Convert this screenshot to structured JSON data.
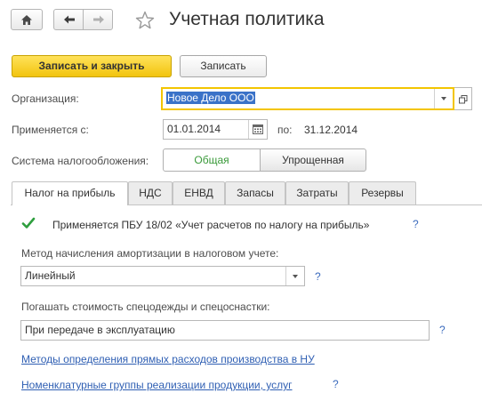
{
  "window": {
    "title": "Учетная политика"
  },
  "toolbar": {
    "save_close_label": "Записать и закрыть",
    "save_label": "Записать"
  },
  "form": {
    "organization_label": "Организация:",
    "organization_value": "Новое Дело ООО",
    "applies_from_label": "Применяется с:",
    "applies_from_value": "01.01.2014",
    "applies_to_label": "по:",
    "applies_to_value": "31.12.2014",
    "tax_system_label": "Система налогообложения:",
    "tax_system_options": [
      "Общая",
      "Упрощенная"
    ],
    "tax_system_selected": "Общая"
  },
  "tabs": [
    {
      "label": "Налог на прибыль",
      "active": true
    },
    {
      "label": "НДС"
    },
    {
      "label": "ЕНВД"
    },
    {
      "label": "Запасы"
    },
    {
      "label": "Затраты"
    },
    {
      "label": "Резервы"
    }
  ],
  "profit_tax": {
    "pbu_checkbox_label": "Применяется ПБУ 18/02 «Учет расчетов по налогу на прибыль»",
    "pbu_checked": true,
    "help_mark": "?",
    "depreciation_label": "Метод начисления амортизации в налоговом учете:",
    "depreciation_value": "Линейный",
    "workwear_label": "Погашать стоимость спецодежды и спецоснастки:",
    "workwear_value": "При передаче в эксплуатацию",
    "link_direct_costs": "Методы определения прямых расходов производства в НУ",
    "link_nomenclature_groups": "Номенклатурные группы реализации продукции, услуг"
  },
  "colors": {
    "primary_button": "#f2c40e",
    "focus_border": "#f3c500",
    "link": "#2f5fb3",
    "checkmark": "#2e9e3e",
    "selected_text_bg": "#3a72c8"
  }
}
